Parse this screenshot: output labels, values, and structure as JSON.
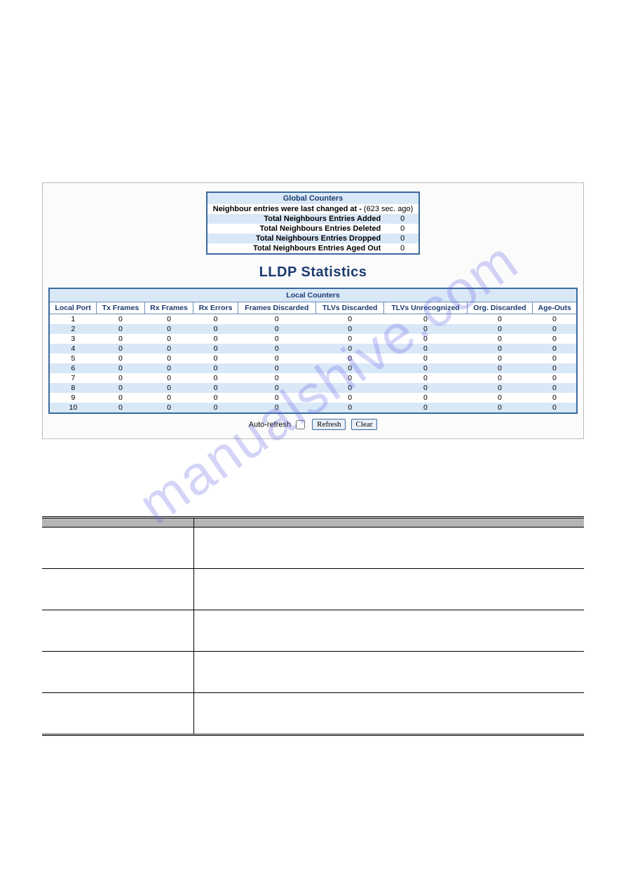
{
  "watermark": "manualshive.com",
  "panel": {
    "global": {
      "title": "Global Counters",
      "changed_label": "Neighbour entries were last changed at  -",
      "changed_suffix": " (623 sec. ago)",
      "rows": [
        {
          "label": "Total Neighbours Entries Added",
          "value": "0"
        },
        {
          "label": "Total Neighbours Entries Deleted",
          "value": "0"
        },
        {
          "label": "Total Neighbours Entries Dropped",
          "value": "0"
        },
        {
          "label": "Total Neighbours Entries Aged Out",
          "value": "0"
        }
      ]
    },
    "stats_title": "LLDP Statistics",
    "local": {
      "title": "Local Counters",
      "headers": [
        "Local Port",
        "Tx Frames",
        "Rx Frames",
        "Rx Errors",
        "Frames Discarded",
        "TLVs Discarded",
        "TLVs Unrecognized",
        "Org. Discarded",
        "Age-Outs"
      ],
      "rows": [
        [
          "1",
          "0",
          "0",
          "0",
          "0",
          "0",
          "0",
          "0",
          "0"
        ],
        [
          "2",
          "0",
          "0",
          "0",
          "0",
          "0",
          "0",
          "0",
          "0"
        ],
        [
          "3",
          "0",
          "0",
          "0",
          "0",
          "0",
          "0",
          "0",
          "0"
        ],
        [
          "4",
          "0",
          "0",
          "0",
          "0",
          "0",
          "0",
          "0",
          "0"
        ],
        [
          "5",
          "0",
          "0",
          "0",
          "0",
          "0",
          "0",
          "0",
          "0"
        ],
        [
          "6",
          "0",
          "0",
          "0",
          "0",
          "0",
          "0",
          "0",
          "0"
        ],
        [
          "7",
          "0",
          "0",
          "0",
          "0",
          "0",
          "0",
          "0",
          "0"
        ],
        [
          "8",
          "0",
          "0",
          "0",
          "0",
          "0",
          "0",
          "0",
          "0"
        ],
        [
          "9",
          "0",
          "0",
          "0",
          "0",
          "0",
          "0",
          "0",
          "0"
        ],
        [
          "10",
          "0",
          "0",
          "0",
          "0",
          "0",
          "0",
          "0",
          "0"
        ]
      ]
    },
    "controls": {
      "auto_refresh_label": "Auto-refresh",
      "refresh_label": "Refresh",
      "clear_label": "Clear"
    }
  },
  "desc": {
    "headers": [
      "",
      ""
    ],
    "rows": [
      [
        "",
        ""
      ],
      [
        "",
        ""
      ],
      [
        "",
        ""
      ],
      [
        "",
        ""
      ],
      [
        "",
        ""
      ]
    ]
  }
}
